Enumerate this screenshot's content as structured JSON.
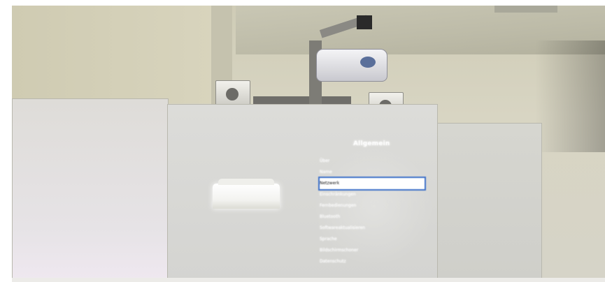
{
  "projected_screen": {
    "title": "Allgemein",
    "menu_items": [
      {
        "label": "Über",
        "value": ""
      },
      {
        "label": "Name",
        "value": ""
      },
      {
        "label": "Netzwerk",
        "value": ""
      },
      {
        "label": "Einschränkungen",
        "value": ""
      },
      {
        "label": "Fernbedienungen",
        "value": ""
      },
      {
        "label": "Bluetooth",
        "value": ""
      },
      {
        "label": "Softwareaktualisieren",
        "value": ""
      },
      {
        "label": "Sprache",
        "value": ""
      },
      {
        "label": "Bildschirmschoner",
        "value": ""
      },
      {
        "label": "Datenschutz",
        "value": ""
      }
    ],
    "selected_index": 2,
    "selection_color": "#3d71c9"
  },
  "colors": {
    "wall": "#d8d5c3",
    "board": "#d7d7d3"
  }
}
